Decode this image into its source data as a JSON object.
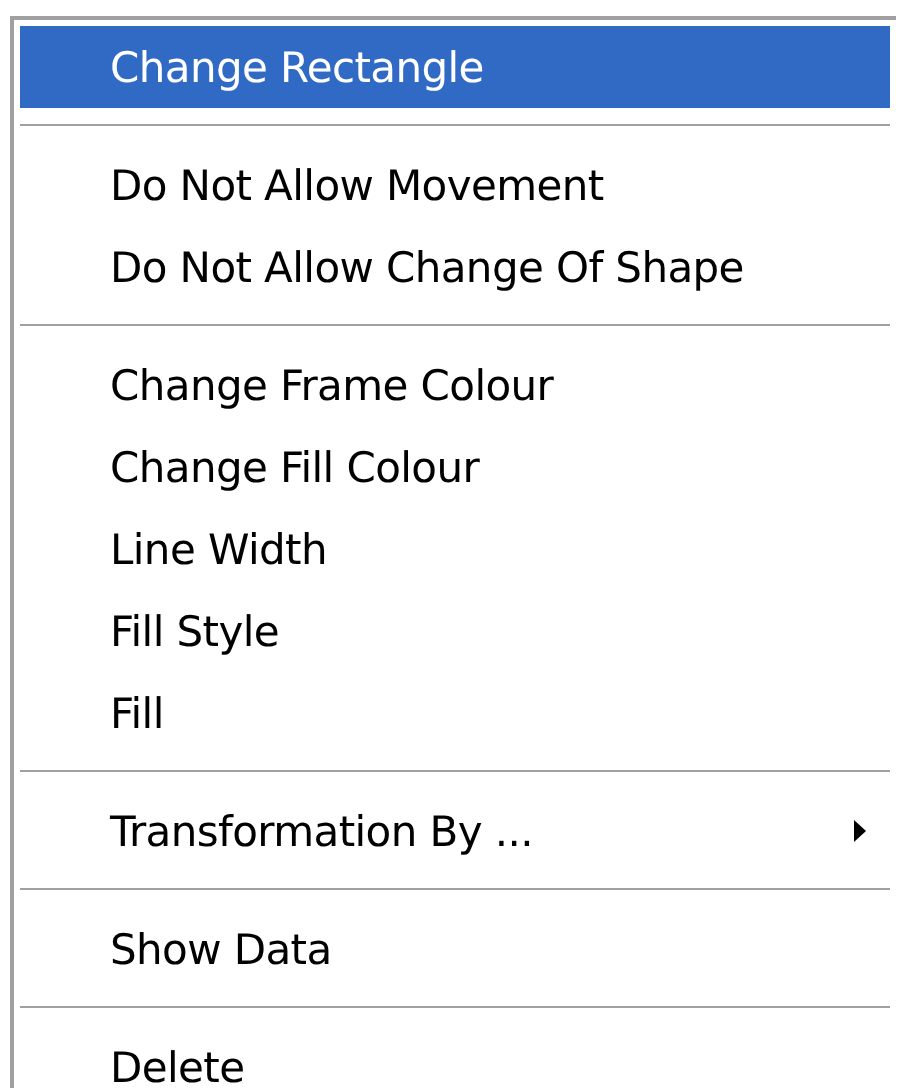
{
  "menu": {
    "items": [
      {
        "kind": "item",
        "label": "Change Rectangle",
        "selected": true
      },
      {
        "kind": "separator"
      },
      {
        "kind": "item",
        "label": "Do Not Allow Movement",
        "selected": false
      },
      {
        "kind": "item",
        "label": "Do Not Allow Change Of Shape",
        "selected": false
      },
      {
        "kind": "separator"
      },
      {
        "kind": "item",
        "label": "Change Frame Colour",
        "selected": false
      },
      {
        "kind": "item",
        "label": "Change Fill Colour",
        "selected": false
      },
      {
        "kind": "item",
        "label": "Line Width",
        "selected": false
      },
      {
        "kind": "item",
        "label": "Fill Style",
        "selected": false
      },
      {
        "kind": "item",
        "label": "Fill",
        "selected": false
      },
      {
        "kind": "separator"
      },
      {
        "kind": "submenu",
        "label": "Transformation By ...",
        "selected": false
      },
      {
        "kind": "separator"
      },
      {
        "kind": "item",
        "label": "Show Data",
        "selected": false
      },
      {
        "kind": "separator"
      },
      {
        "kind": "item",
        "label": "Delete",
        "selected": false
      }
    ]
  }
}
